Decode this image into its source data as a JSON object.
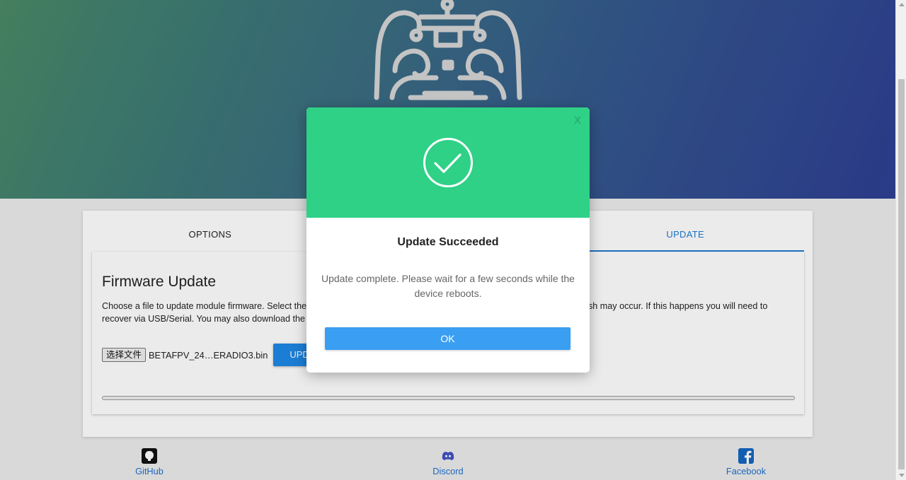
{
  "tabs": [
    {
      "label": "OPTIONS",
      "active": false
    },
    {
      "label": "",
      "active": false
    },
    {
      "label": "UPDATE",
      "active": true
    }
  ],
  "firmware": {
    "title": "Firmware Update",
    "description_line1": "Choose a file to update module firmware. Select the",
    "description_line1_right": "ash may occur. If this happens you will need to",
    "description_line2": "recover via USB/Serial. You may also download the",
    "file_button_label": "选择文件",
    "file_name": "BETAFPV_24…ERADIO3.bin",
    "upload_button_label": "UPD",
    "progress": 0
  },
  "footer": {
    "github": {
      "label": "GitHub",
      "icon": "github-icon"
    },
    "discord": {
      "label": "Discord",
      "icon": "discord-icon"
    },
    "facebook": {
      "label": "Facebook",
      "icon": "facebook-icon"
    }
  },
  "modal": {
    "close_label": "X",
    "icon": "check-circle-icon",
    "title": "Update Succeeded",
    "message": "Update complete. Please wait for a few seconds while the device reboots.",
    "ok_label": "OK",
    "header_color": "#2ed186",
    "ok_color": "#3a9ff2"
  },
  "colors": {
    "accent": "#1e7bd3",
    "link": "#1e6fd0"
  }
}
